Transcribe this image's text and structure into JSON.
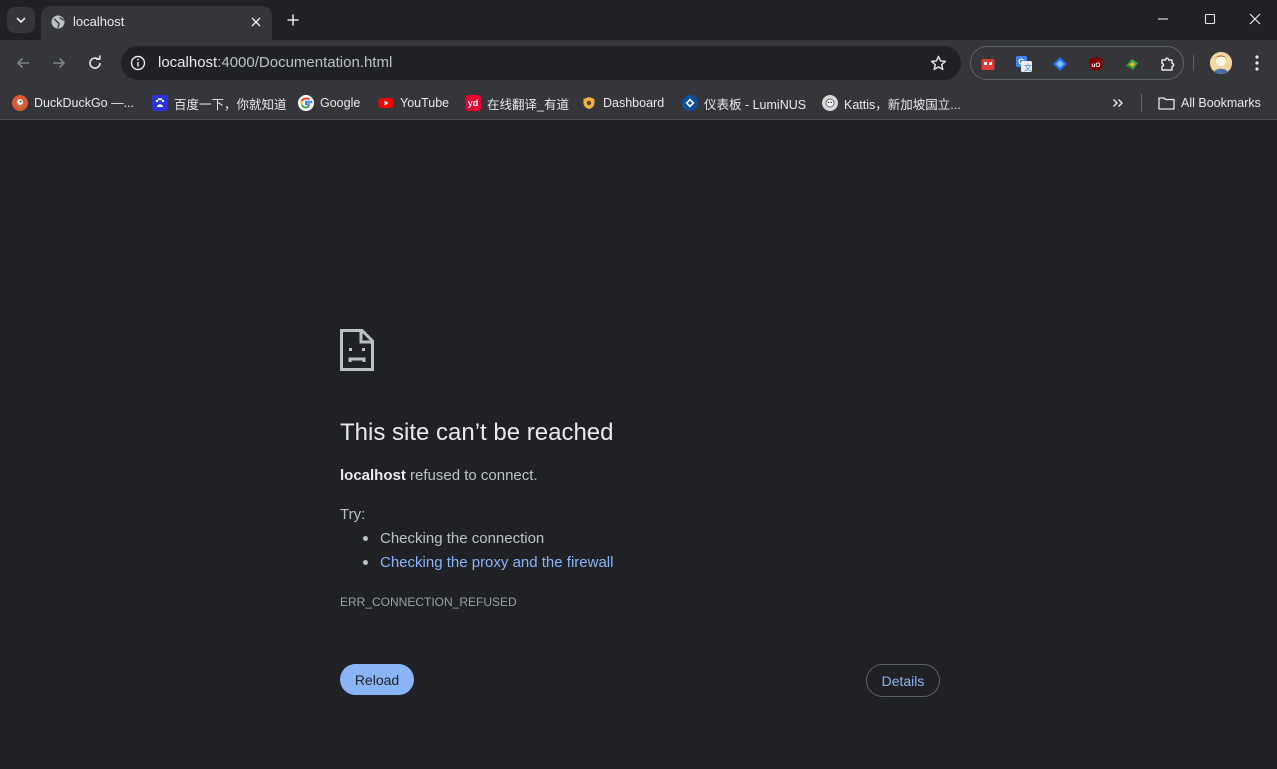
{
  "tab": {
    "title": "localhost"
  },
  "omnibox": {
    "host": "localhost",
    "path": ":4000/Documentation.html"
  },
  "bookmarks": {
    "items": [
      {
        "label": "DuckDuckGo —...",
        "icon": "duckduckgo-icon",
        "color": "#de5833"
      },
      {
        "label": "百度一下，你就知道",
        "icon": "baidu-icon",
        "color": "#2932e1"
      },
      {
        "label": "Google",
        "icon": "google-icon",
        "color": "#ffffff"
      },
      {
        "label": "YouTube",
        "icon": "youtube-icon",
        "color": "#ff0000"
      },
      {
        "label": "在线翻译_有道",
        "icon": "youdao-icon",
        "color": "#e5002d"
      },
      {
        "label": "Dashboard",
        "icon": "dashboard-icon",
        "color": "#f5b041"
      },
      {
        "label": "仪表板 - LumiNUS",
        "icon": "luminus-icon",
        "color": "#0b4fa0"
      },
      {
        "label": "Kattis，新加坡国立...",
        "icon": "kattis-icon",
        "color": "#d8d8d8"
      }
    ],
    "all_bookmarks_label": "All Bookmarks"
  },
  "error": {
    "heading": "This site can’t be reached",
    "host": "localhost",
    "message": "refused to connect.",
    "try_label": "Try:",
    "suggestions": [
      {
        "text": "Checking the connection",
        "link": false
      },
      {
        "text": "Checking the proxy and the firewall",
        "link": true
      }
    ],
    "code": "ERR_CONNECTION_REFUSED",
    "reload_label": "Reload",
    "details_label": "Details"
  },
  "colors": {
    "background": "#202124",
    "toolbar": "#35363a",
    "accent": "#8ab4f8",
    "text": "#e8eaed",
    "secondary_text": "#bdc1c6"
  }
}
